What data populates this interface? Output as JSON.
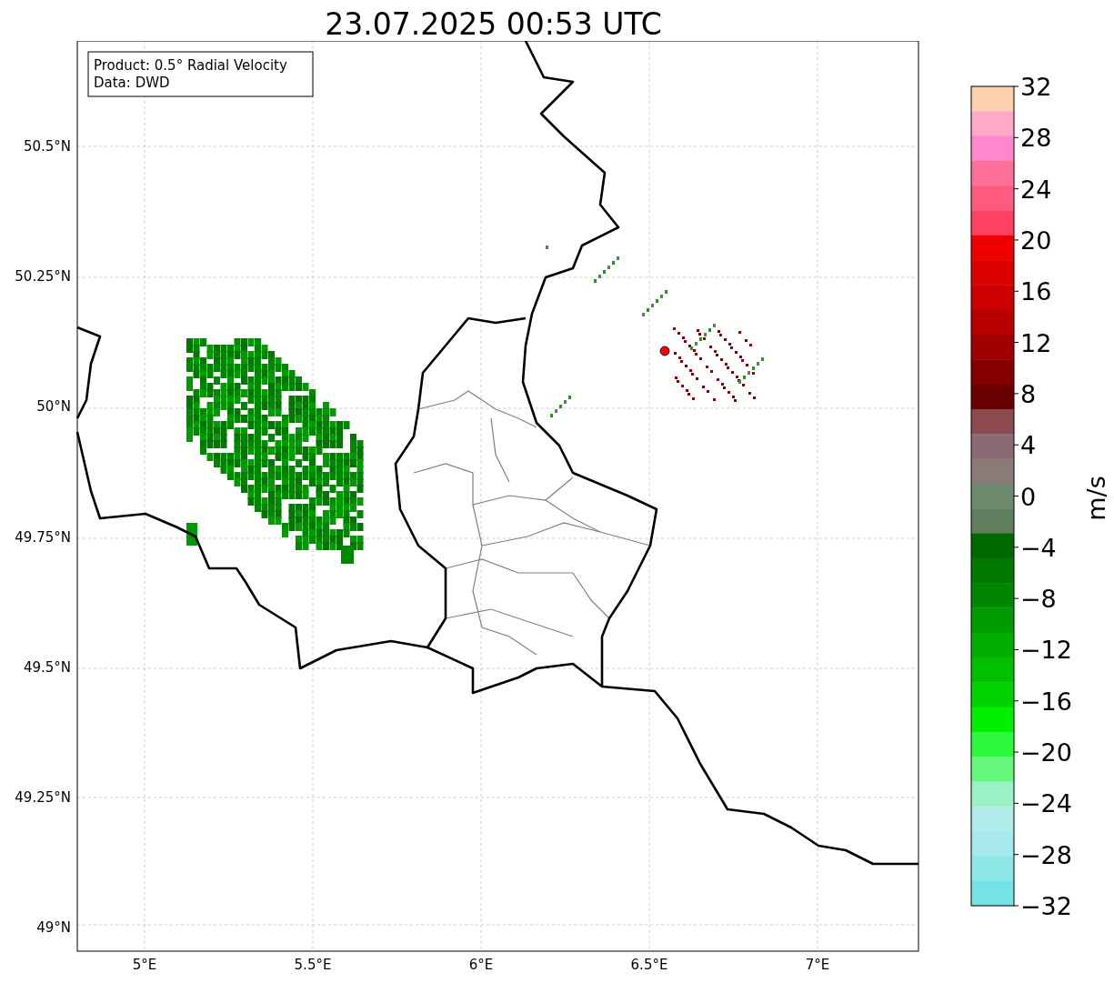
{
  "title": "23.07.2025 00:53 UTC",
  "info_box": [
    "Product: 0.5° Radial Velocity",
    "Data: DWD"
  ],
  "y_ticks": [
    "50.5°N",
    "50.25°N",
    "50°N",
    "49.75°N",
    "49.5°N",
    "49.25°N",
    "49°N"
  ],
  "x_ticks": [
    "5°E",
    "5.5°E",
    "6°E",
    "6.5°E",
    "7°E"
  ],
  "colorbar": {
    "label": "m/s",
    "ticks": [
      "32",
      "28",
      "24",
      "20",
      "16",
      "12",
      "8",
      "4",
      "0",
      "−4",
      "−8",
      "−12",
      "−16",
      "−20",
      "−24",
      "−28",
      "−32"
    ],
    "segments": [
      {
        "color": "#ffd0b0"
      },
      {
        "color": "#ffa8c8"
      },
      {
        "color": "#ff88cc"
      },
      {
        "color": "#ff7099"
      },
      {
        "color": "#ff5a80"
      },
      {
        "color": "#ff4060"
      },
      {
        "color": "#f00000"
      },
      {
        "color": "#dd0000"
      },
      {
        "color": "#cc0000"
      },
      {
        "color": "#b80000"
      },
      {
        "color": "#a00000"
      },
      {
        "color": "#870000"
      },
      {
        "color": "#6a0000"
      },
      {
        "color": "#8a4a50"
      },
      {
        "color": "#8a6a74"
      },
      {
        "color": "#8a7a78"
      },
      {
        "color": "#6e8a6e"
      },
      {
        "color": "#5e7e5e"
      },
      {
        "color": "#006800"
      },
      {
        "color": "#007800"
      },
      {
        "color": "#008700"
      },
      {
        "color": "#009b00"
      },
      {
        "color": "#00ae00"
      },
      {
        "color": "#00c000"
      },
      {
        "color": "#00d400"
      },
      {
        "color": "#00f000"
      },
      {
        "color": "#2cf93c"
      },
      {
        "color": "#64f77c"
      },
      {
        "color": "#9af2c5"
      },
      {
        "color": "#b2ecea"
      },
      {
        "color": "#a6e9ec"
      },
      {
        "color": "#8ee8ea"
      },
      {
        "color": "#75e3e6"
      }
    ]
  }
}
